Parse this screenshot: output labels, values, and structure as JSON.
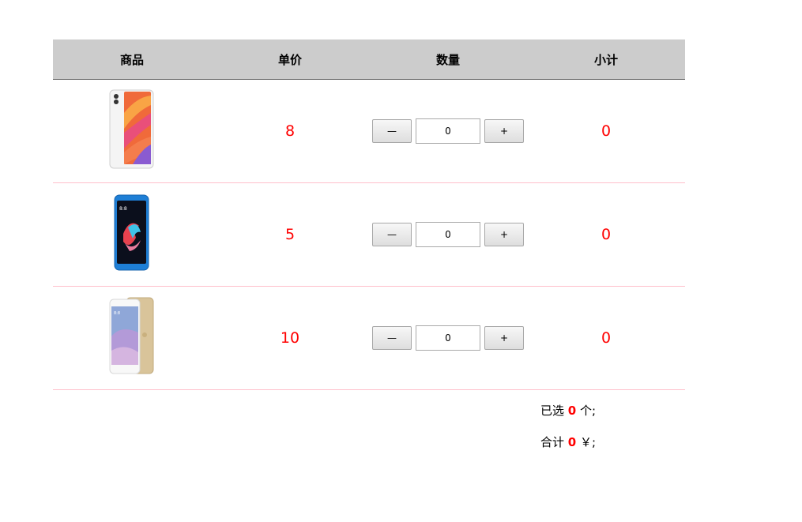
{
  "table": {
    "headers": {
      "goods": "商品",
      "price": "单价",
      "quantity": "数量",
      "subtotal": "小计"
    },
    "rows": [
      {
        "product_icon": "white-smartphone-icon",
        "price": "8",
        "quantity": "0",
        "subtotal": "0"
      },
      {
        "product_icon": "blue-smartphone-icon",
        "price": "5",
        "quantity": "0",
        "subtotal": "0"
      },
      {
        "product_icon": "gold-smartphone-icon",
        "price": "10",
        "quantity": "0",
        "subtotal": "0"
      }
    ],
    "buttons": {
      "minus": "—",
      "plus": "+"
    }
  },
  "summary": {
    "selected_prefix": "已选",
    "selected_count": "0",
    "selected_suffix": "个;",
    "total_prefix": "合计",
    "total_amount": "0",
    "total_suffix": "￥;"
  },
  "colors": {
    "header_bg": "#cccccc",
    "row_divider": "#ffc0cb",
    "price_text": "#ff0000"
  }
}
